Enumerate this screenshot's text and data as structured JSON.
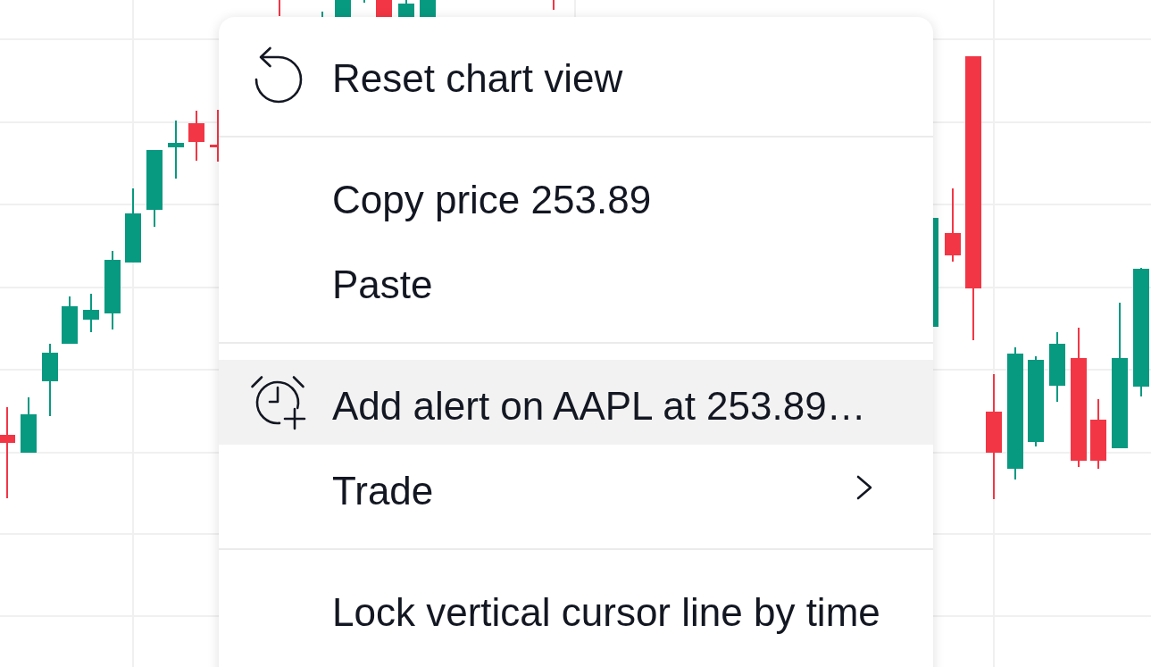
{
  "chart": {
    "kind": "candlestick"
  },
  "context_menu": {
    "groups": [
      [
        {
          "label": "Reset chart view",
          "selected": false,
          "submenu": false
        }
      ],
      [
        {
          "label": "Copy price 253.89",
          "selected": false,
          "submenu": false
        },
        {
          "label": "Paste",
          "selected": false,
          "submenu": false
        }
      ],
      [
        {
          "label": "Add alert on AAPL at 253.89…",
          "selected": true,
          "submenu": false
        },
        {
          "label": "Trade",
          "selected": false,
          "submenu": true
        }
      ],
      [
        {
          "label": "Lock vertical cursor line by time",
          "selected": false,
          "submenu": false
        }
      ]
    ]
  }
}
